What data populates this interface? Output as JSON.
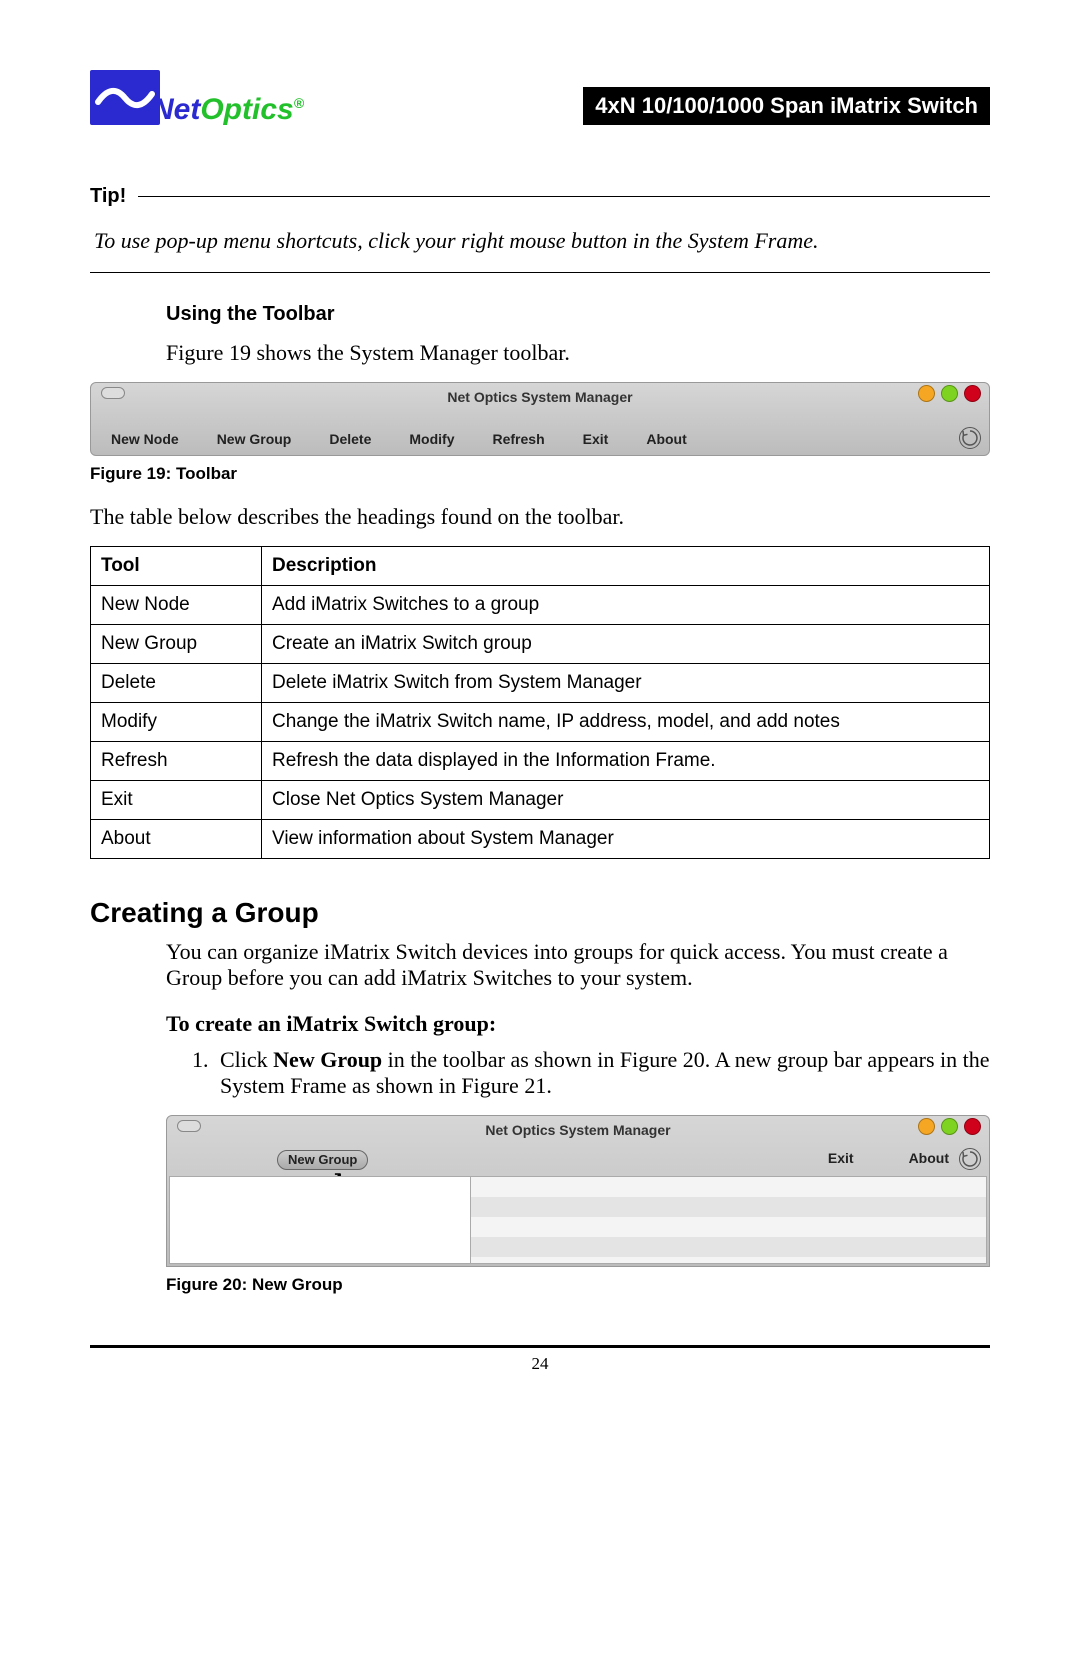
{
  "header": {
    "logo_net": "Net",
    "logo_optics": "Optics",
    "logo_reg": "®",
    "title": "4xN 10/100/1000 Span iMatrix Switch"
  },
  "tip": {
    "label": "Tip!",
    "text": "To use pop-up menu shortcuts, click your right mouse button in the System Frame."
  },
  "section1": {
    "heading": "Using the Toolbar",
    "intro": "Figure 19 shows the System Manager toolbar.",
    "fig19_label": "Figure 19:",
    "fig19_name": "  Toolbar",
    "post_text": "The table below describes the headings found on the toolbar."
  },
  "toolbar": {
    "app_title": "Net Optics System Manager",
    "items": [
      "New Node",
      "New Group",
      "Delete",
      "Modify",
      "Refresh",
      "Exit",
      "About"
    ]
  },
  "table": {
    "head_tool": "Tool",
    "head_desc": "Description",
    "rows": [
      {
        "tool": "New Node",
        "desc": "Add iMatrix Switches to a group"
      },
      {
        "tool": "New Group",
        "desc": "Create an iMatrix Switch group"
      },
      {
        "tool": "Delete",
        "desc": "Delete iMatrix Switch from System Manager"
      },
      {
        "tool": "Modify",
        "desc": "Change the iMatrix Switch name, IP address, model, and add notes"
      },
      {
        "tool": "Refresh",
        "desc": "Refresh the data displayed in the Information Frame."
      },
      {
        "tool": "Exit",
        "desc": "Close Net Optics System Manager"
      },
      {
        "tool": "About",
        "desc": "View information about System Manager"
      }
    ]
  },
  "section2": {
    "heading": "Creating a Group",
    "intro": "You can organize iMatrix Switch devices into groups for quick access. You must create a Group before you can add iMatrix Switches to your system.",
    "subhead": "To create an iMatrix Switch group:",
    "step1_pre": "Click ",
    "step1_bold": "New Group",
    "step1_post": " in the toolbar as shown in Figure 20. A new group bar appears in the System Frame as shown in Figure 21.",
    "fig20_label": "Figure 20:",
    "fig20_name": " New Group"
  },
  "fig20": {
    "app_title": "Net Optics System Manager",
    "newgroup_btn": "New Group",
    "tooltip": "New Group",
    "exit": "Exit",
    "about": "About"
  },
  "footer": {
    "page": "24"
  }
}
